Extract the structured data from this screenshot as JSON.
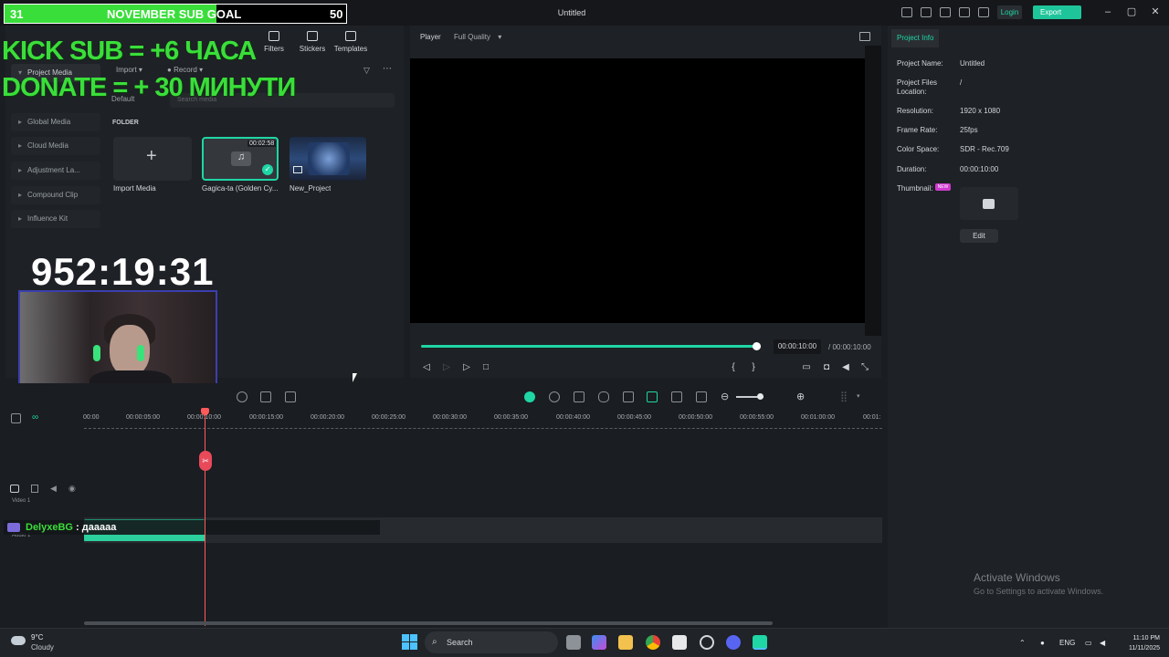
{
  "window": {
    "title": "Untitled",
    "login_label": "Login",
    "export_label": "Export"
  },
  "sub_goal": {
    "start": "31",
    "title": "NOVEMBER SUB GOAL",
    "end": "50",
    "progress": 0.62
  },
  "overlay": {
    "line1": "KICK SUB = +6 ЧАСА",
    "line2": "DONATE = + 30 МИНУТИ",
    "timer": "952:19:31"
  },
  "toolbar": {
    "tabs": [
      "Filters",
      "Stickers",
      "Templates"
    ],
    "import_label": "Import",
    "record_label": "Record",
    "default_label": "Default",
    "search_placeholder": "Search media"
  },
  "sidebar": {
    "items": [
      {
        "label": "Project Media"
      },
      {
        "label": "Global Media"
      },
      {
        "label": "Cloud Media"
      },
      {
        "label": "Adjustment La..."
      },
      {
        "label": "Compound Clip"
      },
      {
        "label": "Influence Kit"
      }
    ]
  },
  "media": {
    "folder_label": "FOLDER",
    "items": [
      {
        "label": "Import Media"
      },
      {
        "label": "Gagica-ta (Golden Cy...",
        "duration": "00:02:58"
      },
      {
        "label": "New_Project"
      }
    ]
  },
  "player": {
    "label": "Player",
    "quality": "Full Quality",
    "current_time": "00:00:10:00",
    "total_time": "/ 00:00:10:00",
    "progress": 1.0
  },
  "project_info": {
    "tab": "Project Info",
    "rows": [
      {
        "key": "Project Name:",
        "value": "Untitled"
      },
      {
        "key": "Project Files Location:",
        "value": "/"
      },
      {
        "key": "Resolution:",
        "value": "1920 x 1080"
      },
      {
        "key": "Frame Rate:",
        "value": "25fps"
      },
      {
        "key": "Color Space:",
        "value": "SDR - Rec.709"
      },
      {
        "key": "Duration:",
        "value": "00:00:10:00"
      }
    ],
    "thumbnail_label": "Thumbnail:",
    "new_badge": "NEW",
    "edit_label": "Edit"
  },
  "timeline": {
    "ticks": [
      "00:00",
      "00:00:05:00",
      "00:00:10:00",
      "00:00:15:00",
      "00:00:20:00",
      "00:00:25:00",
      "00:00:30:00",
      "00:00:35:00",
      "00:00:40:00",
      "00:00:45:00",
      "00:00:50:00",
      "00:00:55:00",
      "00:01:00:00",
      "00:01:"
    ],
    "video_track": "Video 1",
    "audio_track": "Audio 1"
  },
  "chat": {
    "user": "DelyxeBG",
    "message": " : дааааа"
  },
  "activate": {
    "line1": "Activate Windows",
    "line2": "Go to Settings to activate Windows."
  },
  "taskbar": {
    "temp": "9°C",
    "condition": "Cloudy",
    "search": "Search",
    "lang": "ENG",
    "time": "11:10 PM",
    "date": "11/11/2025"
  },
  "colors": {
    "accent": "#1fd6a5",
    "overlay_green": "#3ade3a",
    "playhead": "#ff5a5a"
  }
}
